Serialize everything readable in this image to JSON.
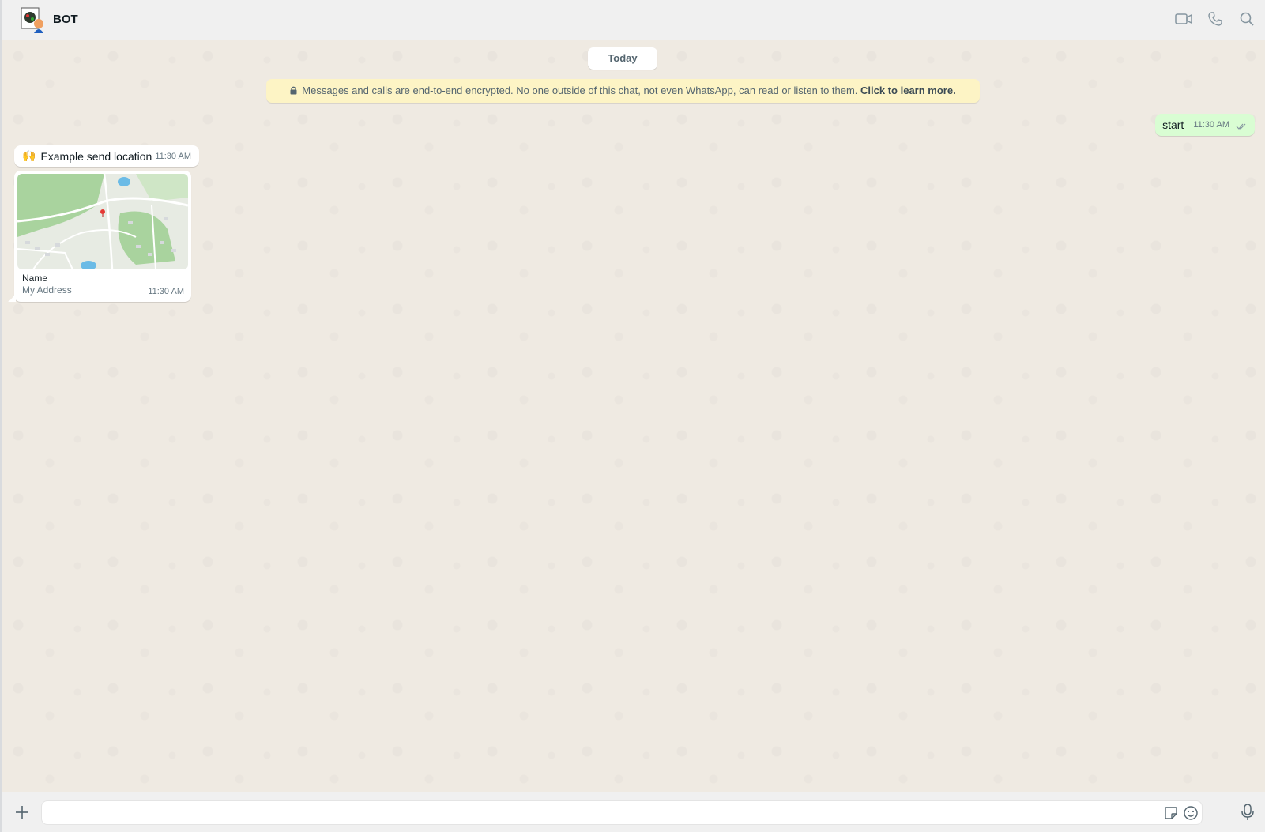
{
  "header": {
    "contact_name": "BOT",
    "actions": [
      "video-call",
      "voice-call",
      "search"
    ]
  },
  "chat": {
    "date_label": "Today",
    "encryption_notice": {
      "text": "Messages and calls are end-to-end encrypted. No one outside of this chat, not even WhatsApp, can read or listen to them.",
      "link": "Click to learn more."
    },
    "messages": [
      {
        "direction": "outgoing",
        "text": "start",
        "time": "11:30 AM",
        "status": "read"
      },
      {
        "direction": "incoming",
        "emoji": "🙌",
        "text": "Example send location",
        "time": "11:30 AM"
      },
      {
        "direction": "incoming",
        "type": "location",
        "name": "Name",
        "address": "My Address",
        "time": "11:30 AM"
      }
    ]
  },
  "composer": {
    "placeholder": "",
    "value": ""
  },
  "colors": {
    "chat_bg": "#efeae2",
    "outgoing_bubble": "#d9fdd3",
    "incoming_bubble": "#ffffff",
    "encryption_banner": "#fdf4c5",
    "header_bg": "#f0f0f0"
  }
}
